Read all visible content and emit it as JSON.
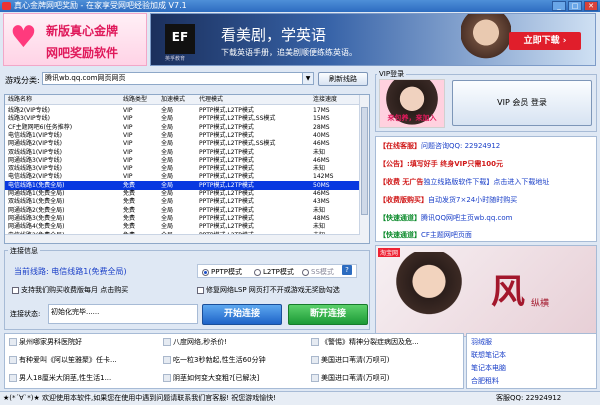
{
  "window": {
    "title": "真心金牌网吧奖励 - 在家享受网吧经验加成 V7.1",
    "buttons": [
      "_",
      "□",
      "✕"
    ]
  },
  "banner_left": {
    "line1": "新版真心金牌",
    "line2": "网吧奖励软件"
  },
  "banner_right": {
    "logo": "EF",
    "logo_sub": "英孚教育",
    "headline": "看美剧，学英语",
    "sub": "下载英语手册，追美剧顺便练练英语。",
    "button": "立即下载 ›"
  },
  "filter": {
    "label": "游戏分类:",
    "value": "腾讯wb.qq.com网页网页",
    "refresh": "刷新线路"
  },
  "table": {
    "headers": [
      "线路名称",
      "线路类型",
      "加速模式",
      "代理模式",
      "连接速度"
    ],
    "rows": [
      [
        "线路2(VIP专线)",
        "VIP",
        "全局",
        "PPTP模式,L2TP模式",
        "17MS"
      ],
      [
        "线路3(VIP专线)",
        "VIP",
        "全局",
        "PPTP模式,L2TP模式,SS模式",
        "15MS"
      ],
      [
        "CF主题网吧6(任务推荐)",
        "VIP",
        "全局",
        "PPTP模式,L2TP模式",
        "28MS"
      ],
      [
        "电信线路1(VIP专线)",
        "VIP",
        "全局",
        "PPTP模式,L2TP模式",
        "40MS"
      ],
      [
        "网通线路2(VIP专线)",
        "VIP",
        "全局",
        "PPTP模式,L2TP模式,SS模式",
        "46MS"
      ],
      [
        "双线线路1(VIP专线)",
        "VIP",
        "全局",
        "PPTP模式,L2TP模式",
        "未知"
      ],
      [
        "网通线路3(VIP专线)",
        "VIP",
        "全局",
        "PPTP模式,L2TP模式",
        "46MS"
      ],
      [
        "双线线路3(VIP专线)",
        "VIP",
        "全局",
        "PPTP模式,L2TP模式",
        "未知"
      ],
      [
        "电信线路2(VIP专线)",
        "VIP",
        "全局",
        "PPTP模式,L2TP模式",
        "142MS"
      ],
      [
        "电信线路1(免费全局)",
        "免费",
        "全局",
        "PPTP模式,L2TP模式",
        "50MS"
      ],
      [
        "网通线路1(免费全局)",
        "免费",
        "全局",
        "PPTP模式,L2TP模式",
        "46MS"
      ],
      [
        "双线线路1(免费全局)",
        "免费",
        "全局",
        "PPTP模式,L2TP模式",
        "43MS"
      ],
      [
        "网通线路2(免费全局)",
        "免费",
        "全局",
        "PPTP模式,L2TP模式",
        "未知"
      ],
      [
        "网通线路3(免费全局)",
        "免费",
        "全局",
        "PPTP模式,L2TP模式",
        "48MS"
      ],
      [
        "网通线路4(免费全局)",
        "免费",
        "全局",
        "PPTP模式,L2TP模式",
        "未知"
      ],
      [
        "电信线路2(免费全局)",
        "免费",
        "全局",
        "PPTP模式,L2TP模式",
        "未知"
      ]
    ],
    "selected_index": 9
  },
  "conn": {
    "title": "连接信息",
    "current": "当前线路: 电信线路1(免费全局)",
    "modes": [
      "PPTP模式",
      "L2TP模式",
      "SS模式"
    ],
    "help": "?",
    "chk1": "支持我们购买收费版每月 点击购买",
    "chk2": "修复网络LSP 网页打不开或游戏无奖励勾选",
    "status_label": "连接状态:",
    "status_value": "初始化完毕......",
    "start": "开始连接",
    "stop": "断开连接"
  },
  "vip": {
    "title": "VIP登录",
    "img_text": "来包养，来加入",
    "login": "VIP 会员 登录"
  },
  "info": [
    {
      "tag": "【在线客服】",
      "text": "问题咨询QQ: 22924912",
      "style": "tag"
    },
    {
      "tag": "【公告】:",
      "text": "填写好手 终身VIP只需100元",
      "style": "tag"
    },
    {
      "tag": "【收费 无广告",
      "text": "独立线路版软件下载】点击进入下载地址",
      "style": "tag"
    },
    {
      "tag": "【收费版购买】",
      "text": "自动发货7×24小时随时购买",
      "style": "tag"
    },
    {
      "tag": "【快速通道】",
      "text": "腾讯QQ网吧主页wb.qq.com",
      "style": "grn"
    },
    {
      "tag": "【快速通道】",
      "text": "CF主题网吧页面",
      "style": "grn"
    }
  ],
  "side_ad": {
    "logo": "淘宝网",
    "big": "风",
    "small": "纵横"
  },
  "news": [
    "泉州哪家男科医院好",
    "八度网络,秒杀价!",
    "《警惕》精神分裂症病因及危...",
    "有种爱叫《阿以笙雅聚》任卡...",
    "吃一粒3秒勃起,性生活60分钟",
    "美国进口苇清(万呗可)",
    "男人18厘米大阴茎,性生活1...",
    "阴茎如何变大变粗?[已解决]",
    "美国进口苇清(万呗可)"
  ],
  "links": [
    "羽绒服",
    "联想笔记本",
    "笔记本电脑",
    "合肥租料"
  ],
  "statusbar": {
    "text": "★(*´∀`*)★ 欢迎使用本软件,如果您在使用中遇到问题请联系我们官客服! 祝您游戏愉快!",
    "qq": "客服QQ: 22924912"
  }
}
